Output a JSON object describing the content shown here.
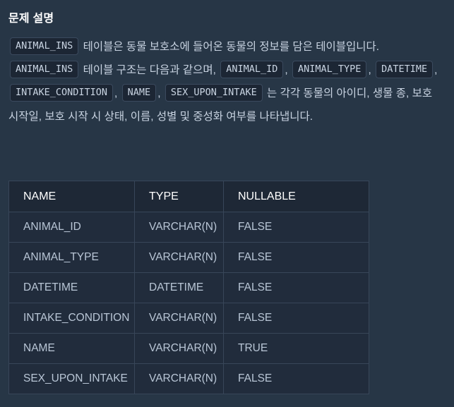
{
  "section": {
    "title": "문제 설명"
  },
  "description": {
    "parts": [
      {
        "type": "code",
        "text": "ANIMAL_INS"
      },
      {
        "type": "text",
        "text": " 테이블은 동물 보호소에 들어온 동물의 정보를 담은 테이블입니다. "
      },
      {
        "type": "code",
        "text": "ANIMAL_INS"
      },
      {
        "type": "text",
        "text": " 테이블 구조는 다음과 같으며, "
      },
      {
        "type": "code",
        "text": "ANIMAL_ID"
      },
      {
        "type": "text",
        "text": ", "
      },
      {
        "type": "code",
        "text": "ANIMAL_TYPE"
      },
      {
        "type": "text",
        "text": ", "
      },
      {
        "type": "code",
        "text": "DATETIME"
      },
      {
        "type": "text",
        "text": ", "
      },
      {
        "type": "code",
        "text": "INTAKE_CONDITION"
      },
      {
        "type": "text",
        "text": ", "
      },
      {
        "type": "code",
        "text": "NAME"
      },
      {
        "type": "text",
        "text": ", "
      },
      {
        "type": "code",
        "text": "SEX_UPON_INTAKE"
      },
      {
        "type": "text",
        "text": " 는 각각 동물의 아이디, 생물 종, 보호 시작일, 보호 시작 시 상태, 이름, 성별 및 중성화 여부를 나타냅니다."
      }
    ]
  },
  "schema_table": {
    "headers": [
      "NAME",
      "TYPE",
      "NULLABLE"
    ],
    "rows": [
      [
        "ANIMAL_ID",
        "VARCHAR(N)",
        "FALSE"
      ],
      [
        "ANIMAL_TYPE",
        "VARCHAR(N)",
        "FALSE"
      ],
      [
        "DATETIME",
        "DATETIME",
        "FALSE"
      ],
      [
        "INTAKE_CONDITION",
        "VARCHAR(N)",
        "FALSE"
      ],
      [
        "NAME",
        "VARCHAR(N)",
        "TRUE"
      ],
      [
        "SEX_UPON_INTAKE",
        "VARCHAR(N)",
        "FALSE"
      ]
    ]
  },
  "colors": {
    "page_background": "#273646",
    "table_background": "#212c3c",
    "table_header_background": "#1e2836",
    "border": "#384659",
    "code_chip_background": "#1c2634",
    "code_chip_border": "#3b4a5e",
    "body_text": "#c8d3e1",
    "heading_text": "#ffffff"
  }
}
